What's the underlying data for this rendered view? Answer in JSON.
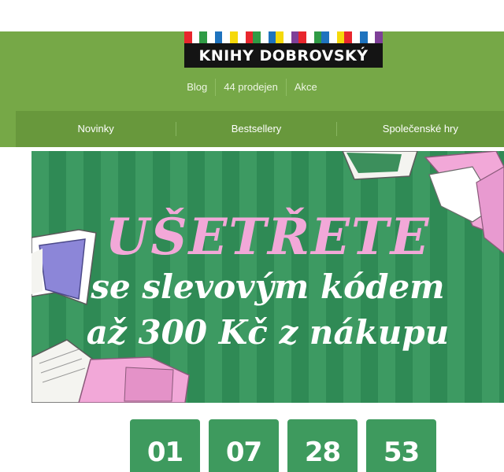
{
  "logo": {
    "text": "KNIHY DOBROVSKÝ",
    "stripe_colors": [
      "#e8262d",
      "#ffffff",
      "#2f9b45",
      "#ffffff",
      "#1e73be",
      "#ffffff",
      "#f5d90a",
      "#ffffff",
      "#e8262d",
      "#2f9b45",
      "#ffffff",
      "#1e73be",
      "#f5d90a",
      "#ffffff",
      "#7e3f98",
      "#e8262d",
      "#ffffff",
      "#2f9b45",
      "#1e73be",
      "#ffffff",
      "#f5d90a",
      "#e8262d",
      "#ffffff",
      "#1e73be",
      "#ffffff",
      "#7e3f98"
    ]
  },
  "toplinks": [
    "Blog",
    "44 prodejen",
    "Akce"
  ],
  "nav": [
    "Novinky",
    "Bestsellery",
    "Společenské hry"
  ],
  "banner": {
    "line1": "UŠETŘETE",
    "line2": "se slevovým kódem",
    "line3": "až 300 Kč z nákupu"
  },
  "countdown": [
    "01",
    "07",
    "28",
    "53"
  ],
  "colors": {
    "header_green": "#76a847",
    "nav_green": "#68983c",
    "banner_green": "#3d9a62",
    "accent_pink": "#f2a8d8",
    "countdown_green": "#3e9a5e"
  }
}
